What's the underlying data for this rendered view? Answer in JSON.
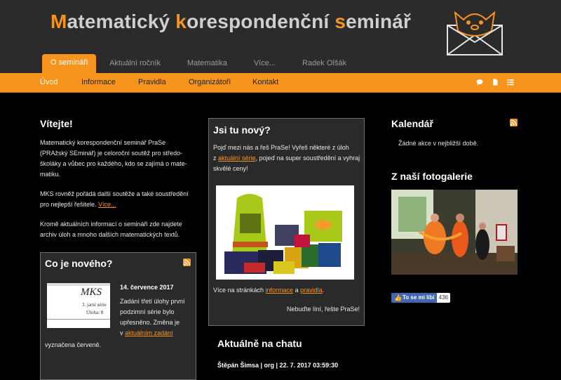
{
  "header": {
    "title_parts": [
      {
        "hl": "M",
        "rest": "atematický "
      },
      {
        "hl": "k",
        "rest": "orespondenční "
      },
      {
        "hl": "s",
        "rest": "eminář"
      }
    ],
    "logo_icon": "envelope-cat-icon"
  },
  "top_tabs": [
    "O semináři",
    "Aktuální ročník",
    "Matematika",
    "Více...",
    "Radek Olšák"
  ],
  "sub_nav": {
    "items": [
      "Úvod",
      "Informace",
      "Pravidla",
      "Organizátoři",
      "Kontakt"
    ],
    "icons": [
      "chat-icon",
      "document-icon",
      "list-icon"
    ]
  },
  "welcome": {
    "title": "Vítejte!",
    "p1_lines": [
      "Matematický korespondenční seminář PraSe",
      "(PRAžský SEminář) je celoroční soutěž pro středo-",
      "školáky a vůbec pro každého, kdo se zajímá o mate-",
      "matiku."
    ],
    "p2_line1": "MKS rovněž pořádá další soutěže a také soustředění",
    "p2_line2_text": "pro nejlepší řešitele. ",
    "p2_link": "Více...",
    "p3_lines": [
      "Kromě aktuálních informací o semináři zde najdete",
      "archiv úloh a mnoho dalších matematických textů."
    ]
  },
  "news": {
    "title": "Co je nového?",
    "thumb": {
      "logo_text": "MKS",
      "line1": "3. jarní série",
      "line2": "Úloha: 8"
    },
    "date": "14. července 2017",
    "lines": [
      "Zadání třetí úlohy první",
      "podzimní série bylo",
      "upřesněno. Změna je"
    ],
    "line4_text": "v ",
    "line4_link": "aktuálním zadání",
    "line5": "vyznačena červeně."
  },
  "new_here": {
    "title": "Jsi tu nový?",
    "line1": "Pojď mezi nás a řeš PraSe! Vyřeš některé z úloh",
    "line2_pre": "z ",
    "line2_link": "aktuální série",
    "line2_post": ", pojeď na super soustředění a vyhraj",
    "line3": "skvělé ceny!",
    "more_pre": "Více na stránkách ",
    "more_link1": "informace",
    "more_mid": " a ",
    "more_link2": "pravidla",
    "more_post": ".",
    "footer": "Nebuďte líní, řešte PraSe!"
  },
  "chat": {
    "title": "Aktuálně na chatu",
    "entry": "Štěpán Šimsa | org | 22. 7. 2017 03:59:30"
  },
  "calendar": {
    "title": "Kalendář",
    "empty": "Žádné akce v nejbližší době."
  },
  "gallery": {
    "title": "Z naší fotogalerie"
  },
  "facebook": {
    "label": "To se mi líbí",
    "count": "436"
  },
  "colors": {
    "accent": "#f7941d",
    "header_bg": "#2b2b2b",
    "page_bg": "#000000"
  }
}
